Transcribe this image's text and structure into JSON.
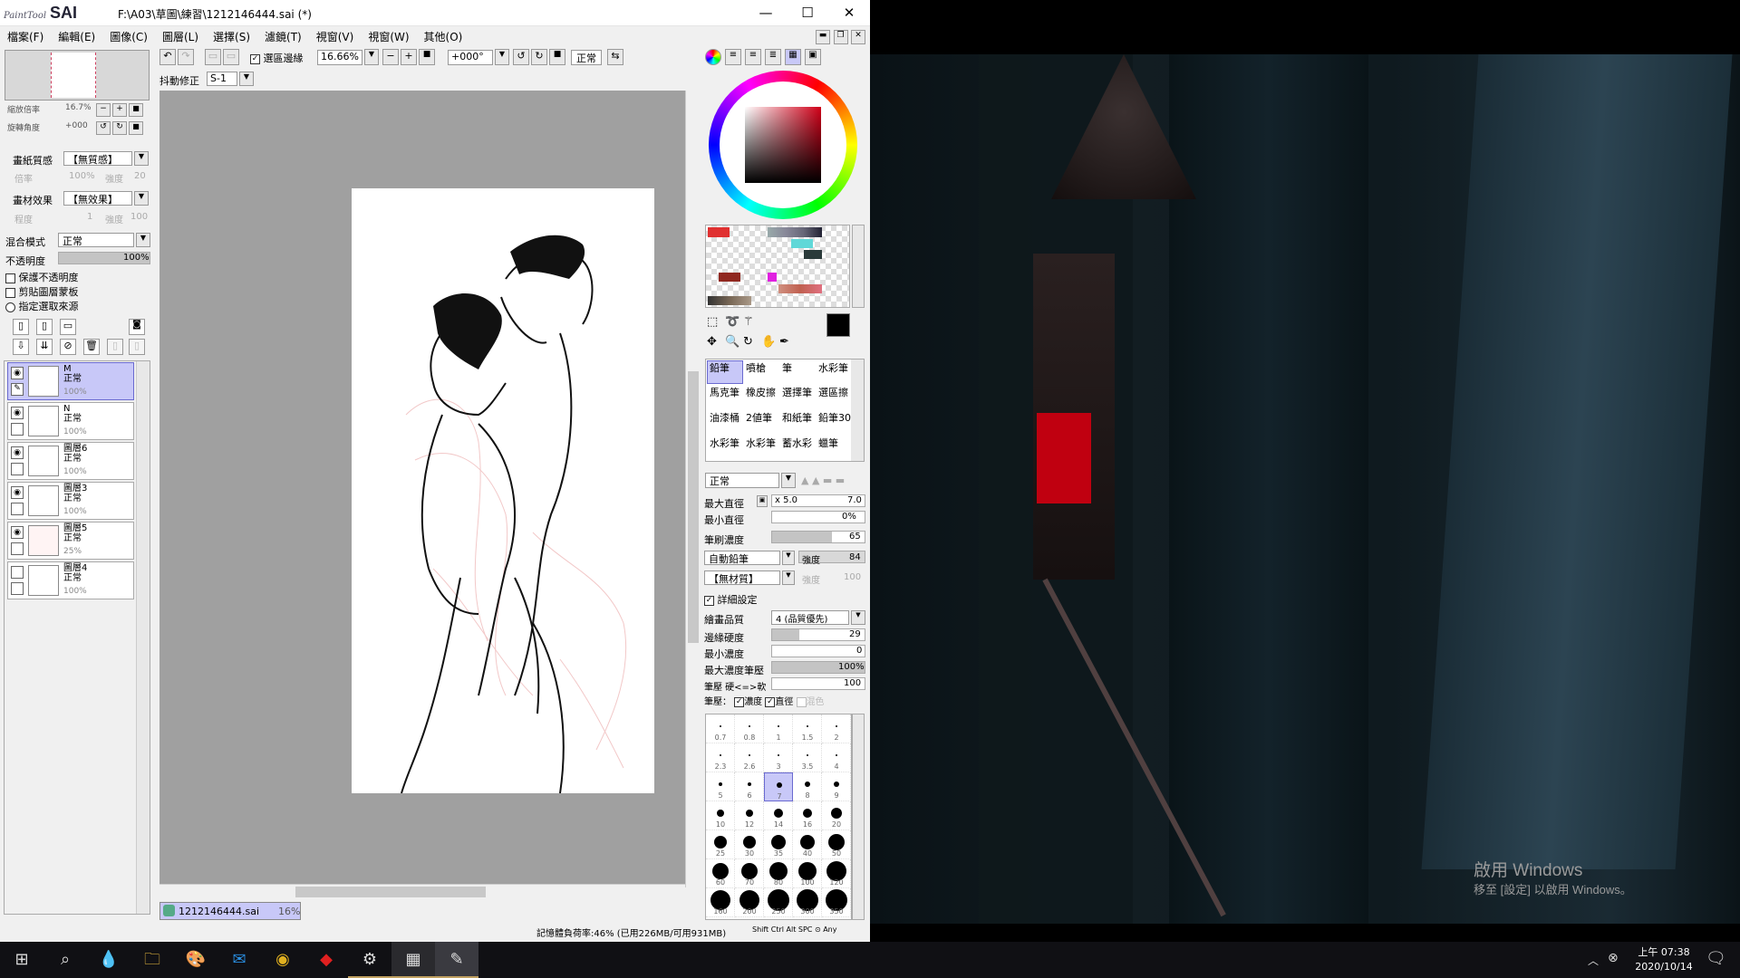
{
  "window": {
    "app_name": "PaintTool",
    "app_brand": "SAI",
    "title": "F:\\A03\\草圖\\練習\\1212146444.sai (*)",
    "min": "—",
    "max": "☐",
    "close": "✕"
  },
  "menu": [
    "檔案(F)",
    "編輯(E)",
    "圖像(C)",
    "圖層(L)",
    "選擇(S)",
    "濾鏡(T)",
    "視窗(V)",
    "視窗(W)",
    "其他(O)"
  ],
  "toolbar": {
    "selection_edge_label": "選區邊緣",
    "selection_edge_checked": true,
    "zoom": "16.66%",
    "rotation": "+000°",
    "blend": "正常",
    "stabilizer_label": "抖動修正",
    "stabilizer_value": "S-1"
  },
  "navigator": {
    "zoom_label": "縮放倍率",
    "zoom_value": "16.7%",
    "angle_label": "旋轉角度",
    "angle_value": "+000"
  },
  "paper": {
    "texture_label": "畫紙質感",
    "texture_value": "【無質感】",
    "scale_label": "倍率",
    "scale_value": "100%",
    "strength_label": "強度",
    "strength_value": "20",
    "effect_label": "畫材效果",
    "effect_value": "【無效果】",
    "degree_label": "程度",
    "degree_value": "1",
    "strength2_label": "強度",
    "strength2_value": "100"
  },
  "layer_props": {
    "blend_label": "混合模式",
    "blend_value": "正常",
    "opacity_label": "不透明度",
    "opacity_value": "100%",
    "opacity_fraction": 1.0,
    "preserve_opacity": "保護不透明度",
    "clip_group": "剪貼圖層蒙板",
    "selection_source": "指定選取來源"
  },
  "layers": [
    {
      "name": "M",
      "mode": "正常",
      "opacity": "100%",
      "selected": true,
      "visible": true
    },
    {
      "name": "N",
      "mode": "正常",
      "opacity": "100%",
      "selected": false,
      "visible": true
    },
    {
      "name": "圖層6",
      "mode": "正常",
      "opacity": "100%",
      "selected": false,
      "visible": true
    },
    {
      "name": "圖層3",
      "mode": "正常",
      "opacity": "100%",
      "selected": false,
      "visible": true
    },
    {
      "name": "圖層5",
      "mode": "正常",
      "opacity": "25%",
      "selected": false,
      "visible": true
    },
    {
      "name": "圖層4",
      "mode": "正常",
      "opacity": "100%",
      "selected": false,
      "visible": false
    }
  ],
  "tools": [
    [
      "鉛筆",
      "噴槍",
      "筆",
      "水彩筆"
    ],
    [
      "馬克筆",
      "橡皮擦",
      "選擇筆",
      "選區擦"
    ],
    [
      "油漆桶",
      "2値筆",
      "和紙筆",
      "鉛筆30"
    ],
    [
      "水彩筆",
      "水彩筆",
      "蓄水彩",
      "蠟筆"
    ]
  ],
  "brush": {
    "blend_value": "正常",
    "max_size_label": "最大直徑",
    "max_size_mult": "x 5.0",
    "max_size_value": "7.0",
    "min_size_label": "最小直徑",
    "min_size_value": "0%",
    "min_size_fraction": 0.0,
    "density_label": "筆刷濃度",
    "density_value": "65",
    "density_fraction": 0.65,
    "shape_value": "自動鉛筆",
    "shape_strength_label": "強度",
    "shape_strength_value": "84",
    "texture_value": "【無材質】",
    "texture_strength_label": "強度",
    "texture_strength_value": "100",
    "advanced_label": "詳細設定",
    "quality_label": "繪畫品質",
    "quality_value": "4 (品質優先)",
    "hardness_label": "邊緣硬度",
    "hardness_value": "29",
    "hardness_fraction": 0.29,
    "min_density_label": "最小濃度",
    "min_density_value": "0",
    "min_density_fraction": 0.0,
    "max_pressure_label": "最大濃度筆壓",
    "max_pressure_value": "100%",
    "max_pressure_fraction": 1.0,
    "pressure_label": "筆壓 硬<=>軟",
    "pressure_value": "100",
    "pressure_fraction": 1.0,
    "pressure_opts_label": "筆壓：",
    "pressure_density": "濃度",
    "pressure_size": "直徑",
    "pressure_blend": "混色"
  },
  "brush_sizes": [
    "0.7",
    "0.8",
    "1",
    "1.5",
    "2",
    "2.3",
    "2.6",
    "3",
    "3.5",
    "4",
    "5",
    "6",
    "7",
    "8",
    "9",
    "10",
    "12",
    "14",
    "16",
    "20",
    "25",
    "30",
    "35",
    "40",
    "50",
    "60",
    "70",
    "80",
    "100",
    "120",
    "160",
    "200",
    "250",
    "300",
    "350"
  ],
  "selected_size": "7",
  "status": {
    "tab": "1212146444.sai",
    "tab_zoom": "16%",
    "memory": "記憶體負荷率:46% (已用226MB/可用931MB)",
    "keys": [
      "Shift",
      "Ctrl",
      "Alt",
      "SPC",
      "⊙",
      "Any"
    ]
  },
  "game_overlay": {
    "activate_title": "啟用 Windows",
    "activate_sub": "移至 [設定] 以啟用 Windows。"
  },
  "taskbar": {
    "time": "上午 07:38",
    "date": "2020/10/14"
  },
  "colors": {
    "accent": "#c8c8f8",
    "blood": "#c00010"
  }
}
